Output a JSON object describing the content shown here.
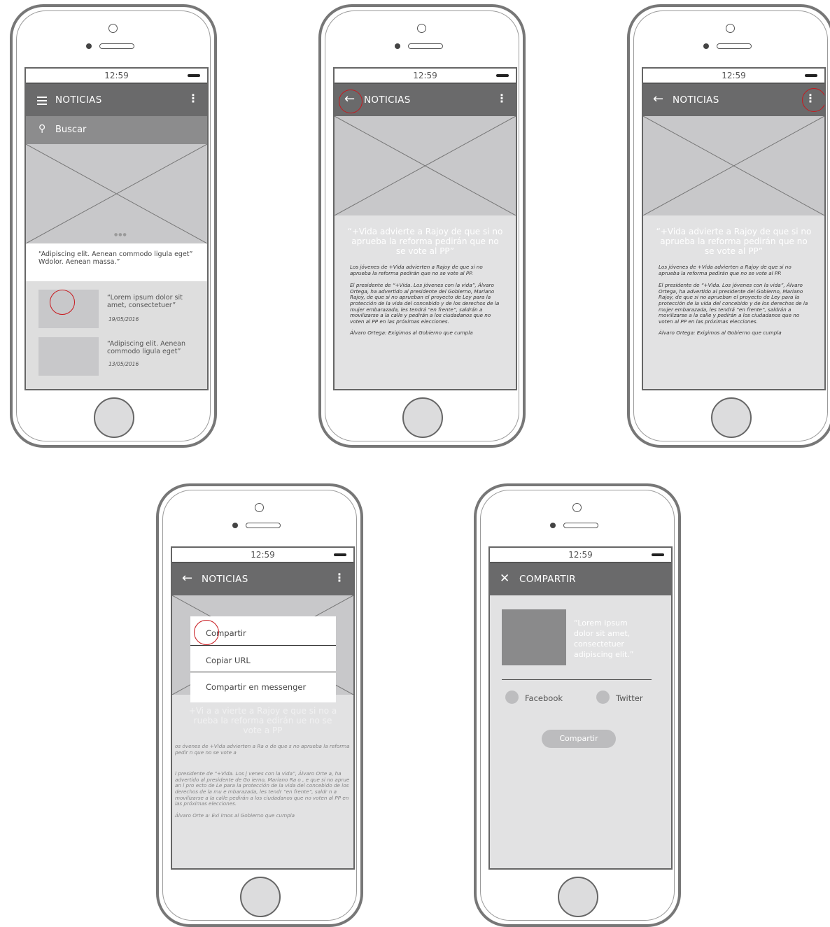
{
  "status_time": "12:59",
  "screen1": {
    "title": "NOTICIAS",
    "search": "Buscar",
    "featured_caption": "“Adipiscing elit. Aenean commodo ligula eget” Wdolor. Aenean massa.”",
    "items": [
      {
        "title": "“Lorem ipsum dolor sit amet, consectetuer”",
        "date": "19/05/2016"
      },
      {
        "title": "“Adipiscing elit. Aenean commodo ligula eget”",
        "date": "13/05/2016"
      }
    ]
  },
  "article": {
    "title": "NOTICIAS",
    "headline": "“+Vida advierte a Rajoy de que si no aprueba la reforma pedirán que no se vote al PP”",
    "lead": "Los jóvenes de +Vida advierten a Rajoy de que si no aprueba la reforma pedirán que no se vote al PP.",
    "body": "El presidente de “+Vida. Los jóvenes con la vida”, Álvaro Ortega, ha advertido al presidente del Gobierno, Mariano Rajoy, de que si no aprueban el proyecto de Ley para la protección de la vida del concebido y de los derechos de la mujer embarazada, les tendrá “en frente”, saldrán a movilizarse a la calle y pedirán a los ciudadanos que no voten al PP en las próximas elecciones.",
    "footer": "Álvaro Ortega: Exigimos al Gobierno que cumpla"
  },
  "menu_screen": {
    "title": "NOTICIAS",
    "menu_items": [
      "Compartir",
      "Copiar URL",
      "Compartir en messenger"
    ],
    "headline": "+Vi  a a  vierte a Rajoy   e que si no a  rueba la reforma   edirán   ue no se vote a  PP",
    "lead": "os  óvenes de +Vida advierten a Ra o   de que s no aprueba la reforma pedir  n que no se vote a",
    "body": "  l presidente de “+Vida. Los j  venes con la vida”, Álvaro Orte  a, ha advertido al presidente de Go  ierno, Mariano Ra o ,    e que si no aprue  an   l pro  ecto de Le   para la protección de la vida del concebido    de los derechos de la mu e   mbarazada, les tendr   “en frente”, saldr  n a movilizarse a la calle    pedirán a los ciudadanos que no voten al PP en las próximas elecciones.",
    "footer": "Álvaro Orte  a: Exi  imos al Gobierno que cumpla"
  },
  "share_screen": {
    "title": "COMPARTIR",
    "preview_text": "“Lorem ipsum dolor sit amet, consectetuer adipiscing elit.”",
    "options": [
      "Facebook",
      "Twitter"
    ],
    "button": "Compartir"
  }
}
